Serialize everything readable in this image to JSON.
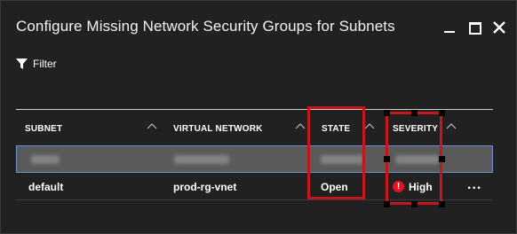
{
  "window": {
    "title": "Configure Missing Network Security Groups for Subnets",
    "controls": {
      "minimize": "minimize",
      "maximize": "maximize",
      "close": "close"
    }
  },
  "toolbar": {
    "filter_label": "Filter"
  },
  "grid": {
    "columns": [
      {
        "label": "SUBNET"
      },
      {
        "label": "VIRTUAL NETWORK"
      },
      {
        "label": "STATE"
      },
      {
        "label": "SEVERITY"
      }
    ],
    "rows": [
      {
        "subnet": "",
        "virtual_network": "",
        "state": "",
        "severity": "",
        "blurred": true
      },
      {
        "subnet": "default",
        "virtual_network": "prod-rg-vnet",
        "state": "Open",
        "severity": "High",
        "more": "..."
      }
    ]
  },
  "icons": {
    "filter": "filter-icon",
    "sort": "sort-ascending-icon",
    "severity_high": "error-icon",
    "severity_high_glyph": "!"
  },
  "colors": {
    "background": "#212121",
    "highlight": "#c4161c",
    "severity_high": "#e81123",
    "selected_row": "#5a5a5a"
  }
}
